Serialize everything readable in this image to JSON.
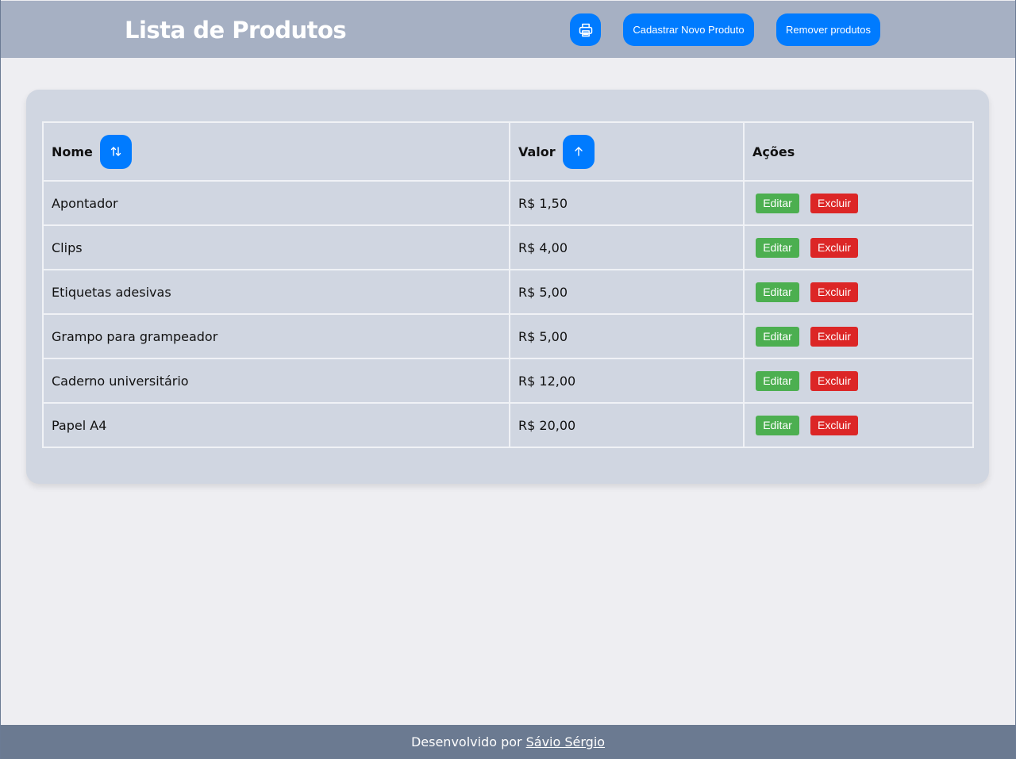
{
  "header": {
    "title": "Lista de Produtos",
    "print_icon": "printer-icon",
    "cadastrar_label": "Cadastrar Novo Produto",
    "remover_label": "Remover produtos"
  },
  "table": {
    "headers": {
      "nome": "Nome",
      "valor": "Valor",
      "acoes": "Ações"
    },
    "sort_icons": {
      "nome": "sort-arrows-icon",
      "valor": "arrow-up-icon"
    },
    "edit_label": "Editar",
    "delete_label": "Excluir",
    "rows": [
      {
        "nome": "Apontador",
        "valor": "R$ 1,50"
      },
      {
        "nome": "Clips",
        "valor": "R$ 4,00"
      },
      {
        "nome": "Etiquetas adesivas",
        "valor": "R$ 5,00"
      },
      {
        "nome": "Grampo para grampeador",
        "valor": "R$ 5,00"
      },
      {
        "nome": "Caderno universitário",
        "valor": "R$ 12,00"
      },
      {
        "nome": "Papel A4",
        "valor": "R$ 20,00"
      }
    ]
  },
  "footer": {
    "text": "Desenvolvido por",
    "author": "Sávio Sérgio"
  },
  "colors": {
    "accent": "#007bff",
    "edit": "#4caf50",
    "delete": "#dc2626",
    "header_bg": "#a6b0c3",
    "footer_bg": "#6b7a91",
    "card_bg": "#d0d6e1"
  }
}
